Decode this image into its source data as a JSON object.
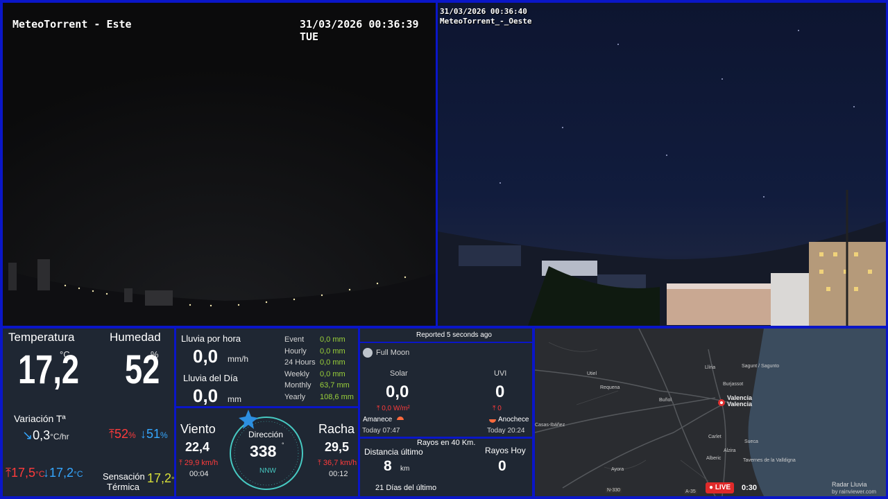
{
  "cam_east": {
    "title": "MeteoTorrent - Este",
    "timestamp": "31/03/2026 00:36:39 TUE"
  },
  "cam_west": {
    "timestamp": "31/03/2026 00:36:40",
    "title": "MeteoTorrent_-_Oeste"
  },
  "temperature": {
    "label": "Temperatura",
    "value": "17,2",
    "unit": "°C",
    "variation_label": "Variación Tª",
    "variation_value": "0,3",
    "variation_unit": "°C/hr",
    "max": "17,5",
    "max_unit": "°C",
    "min": "17,2",
    "min_unit": "°C"
  },
  "humidity": {
    "label": "Humedad",
    "value": "52",
    "unit": "%",
    "max": "52",
    "max_unit": "%",
    "min": "51",
    "min_unit": "%",
    "feels_label_1": "Sensación",
    "feels_label_2": "Térmica",
    "feels_value": "17,2",
    "feels_unit": "°C"
  },
  "rain": {
    "hourly_label": "Lluvia por hora",
    "hourly_value": "0,0",
    "hourly_unit": "mm/h",
    "day_label": "Lluvia del Día",
    "day_value": "0,0",
    "day_unit": "mm",
    "rows": [
      {
        "label": "Event",
        "value": "0,0 mm"
      },
      {
        "label": "Hourly",
        "value": "0,0 mm"
      },
      {
        "label": "24 Hours",
        "value": "0,0 mm"
      },
      {
        "label": "Weekly",
        "value": "0,0 mm"
      },
      {
        "label": "Monthly",
        "value": "63,7 mm"
      },
      {
        "label": "Yearly",
        "value": "108,6 mm"
      }
    ]
  },
  "wind": {
    "label": "Viento",
    "value": "22,4",
    "max_value": "29,9 km/h",
    "time": "00:04",
    "direction_label": "Dirección",
    "direction_value": "338",
    "direction_unit": "°",
    "direction_cardinal": "NNW",
    "gust_label": "Racha",
    "gust_value": "29,5",
    "gust_max": "36,7 km/h",
    "gust_time": "00:12"
  },
  "solar": {
    "reported": "Reported 5 seconds ago",
    "moon": "Full Moon",
    "solar_label": "Solar",
    "solar_value": "0,0",
    "solar_max": "0,0 W/m²",
    "uvi_label": "UVI",
    "uvi_value": "0",
    "uvi_max": "0",
    "sunrise_label": "Amanece",
    "sunrise_time": "Today 07:47",
    "sunset_label": "Anochece",
    "sunset_time": "Today 20:24"
  },
  "lightning": {
    "title": "Rayos en 40 Km.",
    "distance_label": "Distancia último",
    "distance_value": "8",
    "distance_unit": "km",
    "today_label": "Rayos Hoy",
    "today_value": "0",
    "days_value": "21",
    "days_label": "Días del último"
  },
  "radar": {
    "labels": {
      "sagunt": "Sagunt / Sagunto",
      "valencia": "Valencia",
      "valencia2": "Valencia",
      "requena": "Requena",
      "utiel": "Utiel",
      "bunol": "Buñol",
      "sueca": "Sueca",
      "alzira": "Alzira",
      "carlet": "Carlet",
      "ayora": "Ayora",
      "lliria": "Llíria",
      "burjassot": "Burjassot",
      "tavernes": "Tavernes de la Valldigna",
      "casas": "Casas-Ibáñez",
      "alberic": "Alberic"
    },
    "road_1": "N-330",
    "road_2": "A-35",
    "live_label": "LIVE",
    "time": "0:30",
    "credit_1": "Radar Lluvia",
    "credit_2": "by rainviewer.com"
  }
}
